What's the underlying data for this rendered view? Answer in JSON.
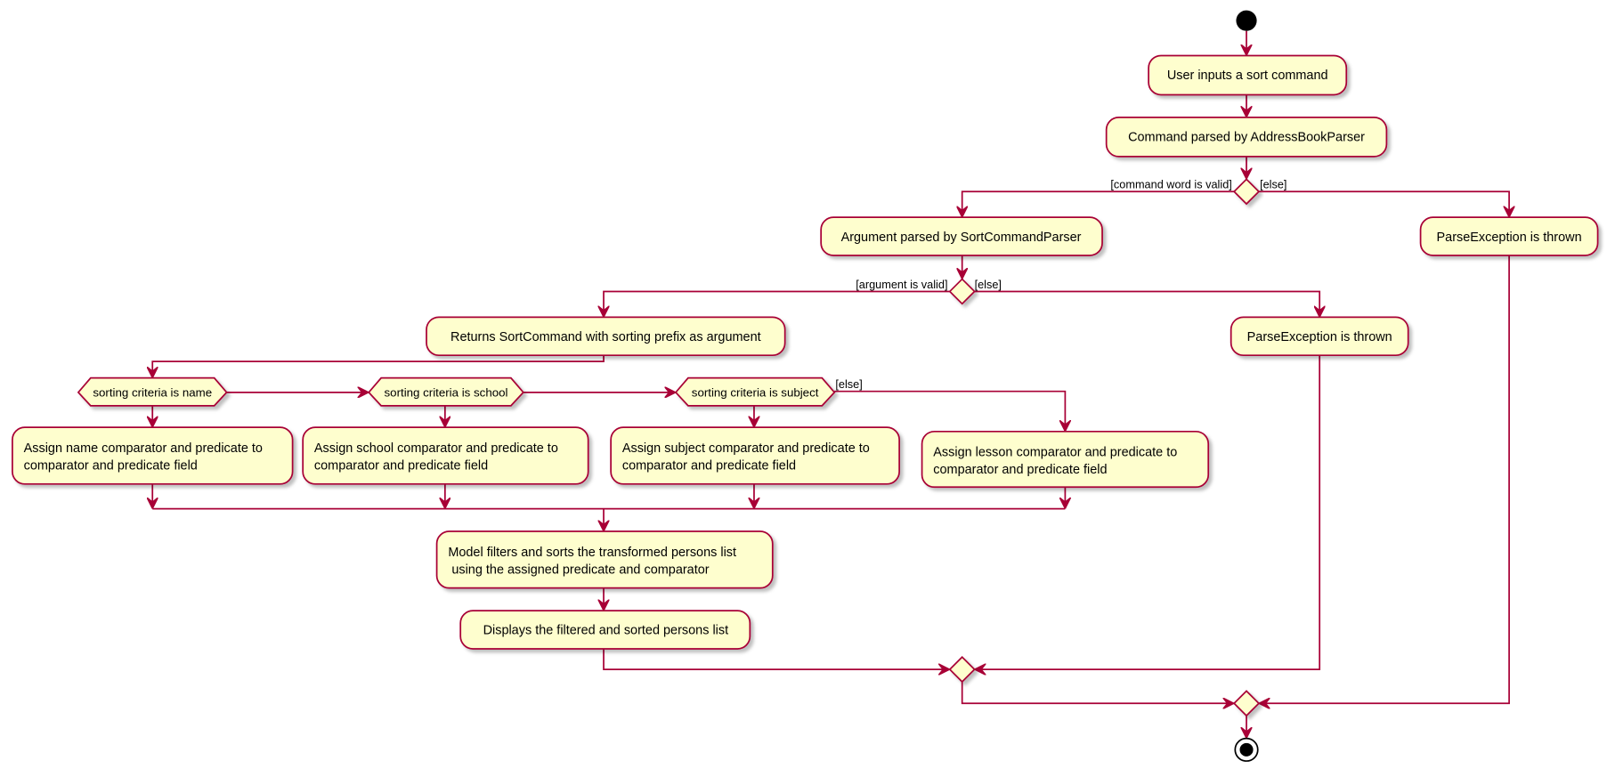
{
  "colors": {
    "border": "#A80036",
    "fill": "#FEFECE",
    "start": "#000000"
  },
  "nodes": {
    "user_input": "User inputs a sort command",
    "address_parser": "Command parsed by AddressBookParser",
    "sort_parser": "Argument parsed by SortCommandParser",
    "parse_exception_1": "ParseException is thrown",
    "parse_exception_2": "ParseException is thrown",
    "returns": "Returns SortCommand with sorting prefix as argument",
    "crit_name": "sorting criteria is name",
    "crit_school": "sorting criteria is school",
    "crit_subject": "sorting criteria is subject",
    "assign_name": [
      "Assign name comparator and predicate to",
      "comparator and predicate field"
    ],
    "assign_school": [
      "Assign school comparator and predicate to",
      "comparator and predicate field"
    ],
    "assign_subject": [
      "Assign subject comparator and predicate to",
      "comparator and predicate field"
    ],
    "assign_lesson": [
      "Assign lesson comparator and predicate to",
      "comparator and predicate field"
    ],
    "model": [
      "Model filters and sorts the transformed persons list",
      " using the assigned predicate and comparator"
    ],
    "display": "Displays the filtered and sorted persons list"
  },
  "guards": {
    "command_valid": "[command word is valid]",
    "command_else": "[else]",
    "argument_valid": "[argument is valid]",
    "argument_else": "[else]",
    "criteria_else": "[else]"
  }
}
